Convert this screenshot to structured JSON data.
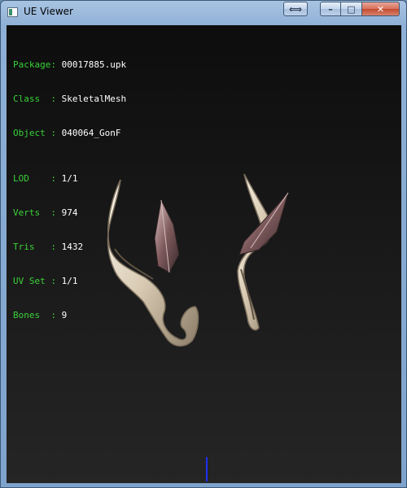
{
  "window": {
    "title": "UE Viewer",
    "buttons": {
      "swap": "⟺",
      "minimize": "–",
      "maximize": "□",
      "close": "✕"
    }
  },
  "info": {
    "package_label": "Package: ",
    "package": "00017885.upk",
    "class_label": "Class  : ",
    "class": "SkeletalMesh",
    "object_label": "Object : ",
    "object": "040064_GonF",
    "lod_label": "LOD    : ",
    "lod": "1/1",
    "verts_label": "Verts  : ",
    "verts": "974",
    "tris_label": "Tris   : ",
    "tris": "1432",
    "uvset_label": "UV Set : ",
    "uvset": "1/1",
    "bones_label": "Bones  : ",
    "bones": "9"
  },
  "colors": {
    "label": "#39d139",
    "value": "#ffffff",
    "axis": "#1e2ff0"
  },
  "icons": {
    "app": "ue-viewer-app-icon"
  }
}
